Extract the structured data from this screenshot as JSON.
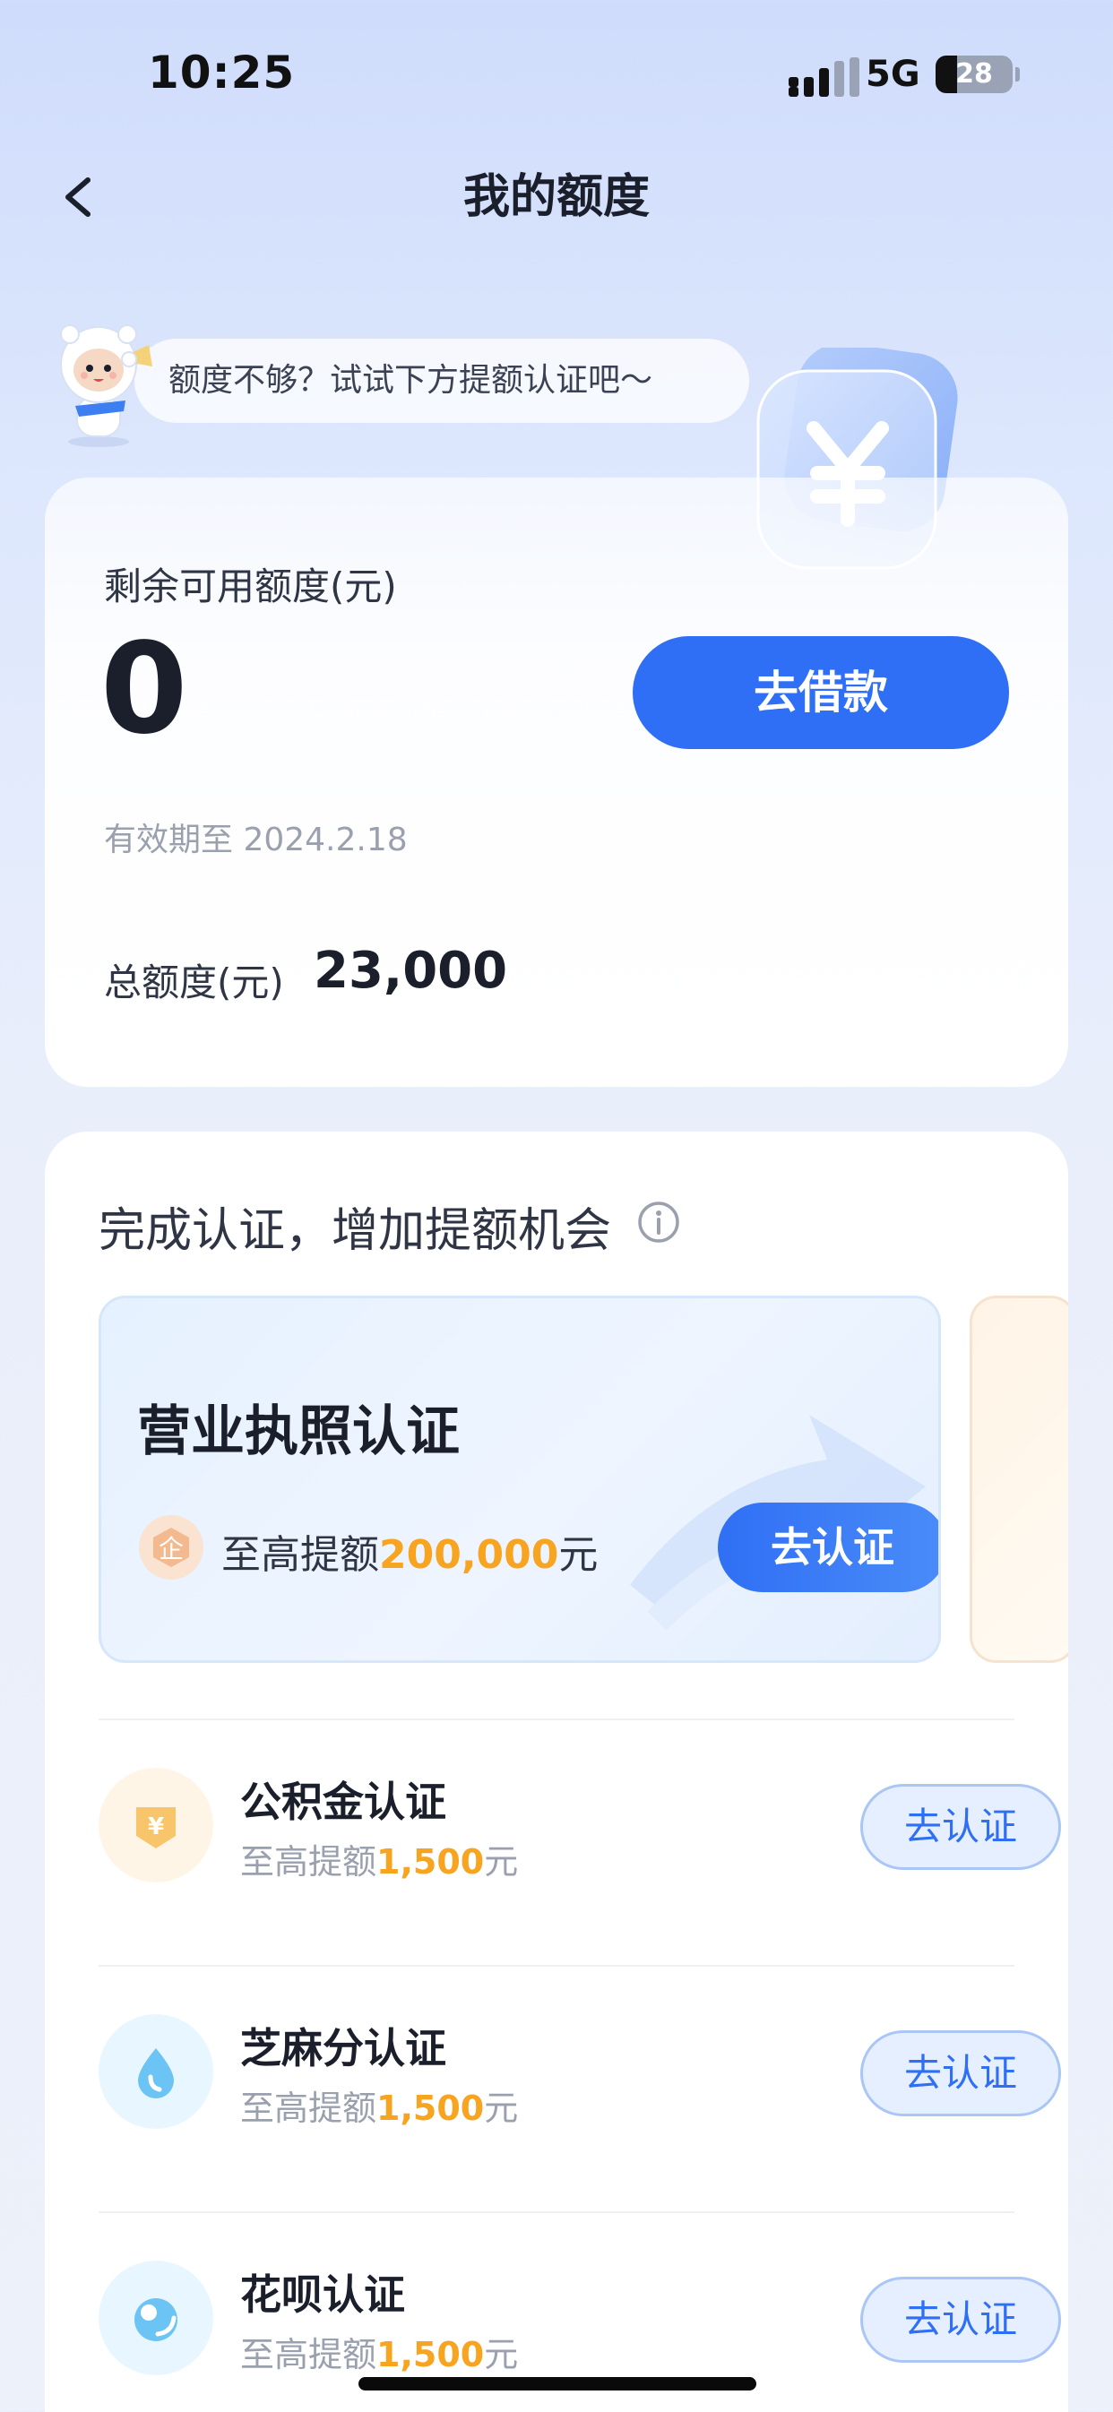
{
  "status_bar": {
    "time": "10:25",
    "network": "5G",
    "battery": "28",
    "battery_level": 0.28
  },
  "nav": {
    "title": "我的额度"
  },
  "tip": {
    "text": "额度不够？试试下方提额认证吧～"
  },
  "credit": {
    "remaining_label": "剩余可用额度(元)",
    "remaining_value": "0",
    "borrow_button": "去借款",
    "valid_until": "有效期至 2024.2.18",
    "total_label": "总额度(元)",
    "total_value": "23,000"
  },
  "certification": {
    "title": "完成认证，增加提额机会",
    "featured": {
      "name": "营业执照认证",
      "quota_prefix": "至高提额",
      "quota_amount": "200,000",
      "quota_unit": "元",
      "button": "去认证"
    },
    "items": [
      {
        "name": "公积金认证",
        "quota_prefix": "至高提额",
        "quota_amount": "1,500",
        "quota_unit": "元",
        "button": "去认证"
      },
      {
        "name": "芝麻分认证",
        "quota_prefix": "至高提额",
        "quota_amount": "1,500",
        "quota_unit": "元",
        "button": "去认证"
      },
      {
        "name": "花呗认证",
        "quota_prefix": "至高提额",
        "quota_amount": "1,500",
        "quota_unit": "元",
        "button": "去认证"
      }
    ]
  },
  "colors": {
    "primary": "#2f6ff5",
    "accent_orange": "#f7a421",
    "background": "#dde7fd"
  }
}
